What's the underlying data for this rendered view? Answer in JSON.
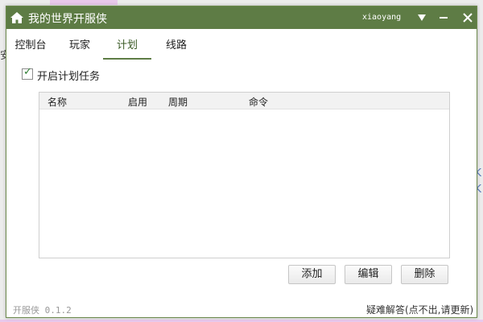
{
  "background": {
    "left_char": "安",
    "right_glyphs": [
      "K",
      "K"
    ]
  },
  "titlebar": {
    "app_title": "我的世界开服侠",
    "username": "xiaoyang",
    "accent_color": "#5e7c45"
  },
  "tabs": [
    {
      "label": "控制台",
      "active": false
    },
    {
      "label": "玩家",
      "active": false
    },
    {
      "label": "计划",
      "active": true
    },
    {
      "label": "线路",
      "active": false
    }
  ],
  "schedule": {
    "enable_label": "开启计划任务",
    "enabled": true,
    "columns": [
      "名称",
      "启用",
      "周期",
      "命令"
    ],
    "rows": []
  },
  "buttons": {
    "add": "添加",
    "edit": "编辑",
    "delete": "删除"
  },
  "footer": {
    "version": "开服侠 0.1.2",
    "help_link": "疑难解答(点不出,请更新)"
  }
}
